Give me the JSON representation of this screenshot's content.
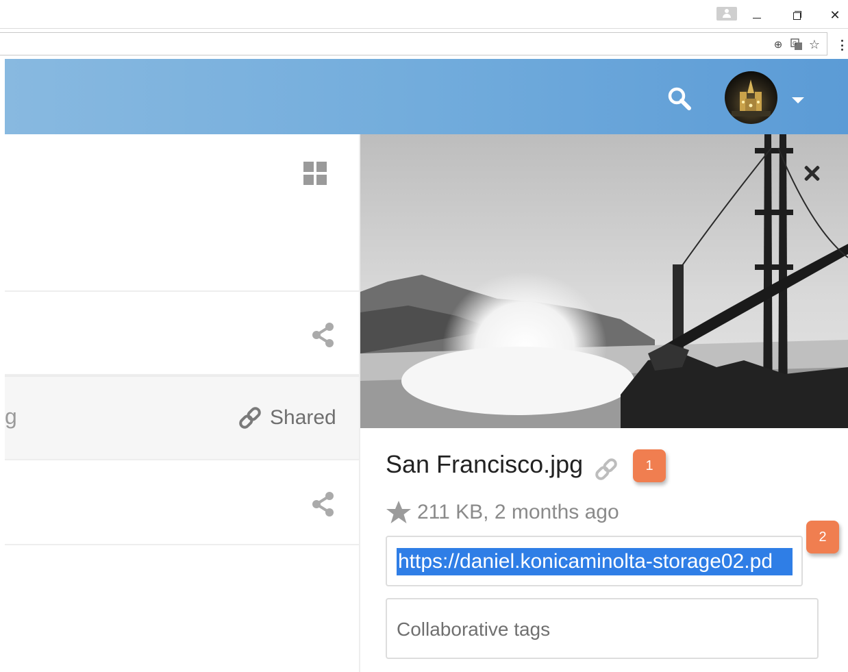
{
  "browser": {
    "window_controls": {
      "minimize": "—",
      "restore": "",
      "close": "✕"
    },
    "toolbar_icons": [
      "zoom-icon",
      "translate-icon",
      "bookmark-star-icon",
      "menu-icon"
    ],
    "toolbar_glyphs": {
      "zoom": "⊕",
      "translate": "⧉",
      "bookmark": "☆"
    }
  },
  "header": {
    "accent_color": "#6aa6da",
    "icons": [
      "search-icon",
      "avatar",
      "caret-down-icon"
    ]
  },
  "file_list": {
    "view_toggle_icon": "grid-view-icon",
    "rows": [
      {
        "name": "",
        "action_icon": "share-icon",
        "status": ""
      },
      {
        "name": "g",
        "action_icon": "link-icon",
        "status": "Shared"
      },
      {
        "name": "",
        "action_icon": "share-icon",
        "status": ""
      }
    ]
  },
  "details": {
    "close_icon": "close-icon",
    "file_name": "San Francisco.jpg",
    "meta": "211 KB, 2 months ago",
    "favorite_icon": "star-icon",
    "share_link": "https://daniel.konicaminolta-storage02.pd",
    "tags_placeholder": "Collaborative tags",
    "callouts": [
      "1",
      "2"
    ],
    "callout_color": "#f07e50",
    "selection_color": "#2f7ee6"
  }
}
